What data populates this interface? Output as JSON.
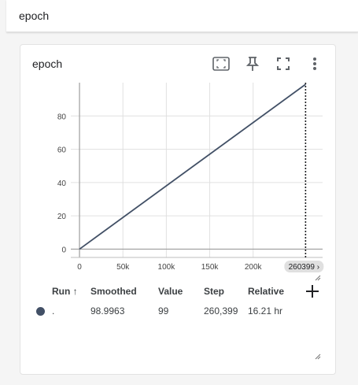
{
  "group": {
    "title": "epoch"
  },
  "card": {
    "title": "epoch",
    "toolbar": [
      "fit-domain-icon",
      "pin-icon",
      "fullscreen-icon",
      "more-vert-icon"
    ]
  },
  "chart_data": {
    "type": "line",
    "x_ticks": [
      "0",
      "50k",
      "100k",
      "150k",
      "200k"
    ],
    "y_ticks": [
      "0",
      "20",
      "40",
      "60",
      "80"
    ],
    "xlim": [
      -10000,
      280000
    ],
    "ylim": [
      -5,
      100
    ],
    "series": [
      {
        "name": ".",
        "color": "#425066",
        "x": [
          0,
          260399
        ],
        "y": [
          0,
          99
        ]
      }
    ],
    "cursor_step": 260399,
    "cursor_label": "260399 ›",
    "grid": true
  },
  "legend": {
    "headers": {
      "run": "Run ↑",
      "smoothed": "Smoothed",
      "value": "Value",
      "step": "Step",
      "relative": "Relative"
    },
    "rows": [
      {
        "run": ".",
        "smoothed": "98.9963",
        "value": "99",
        "step": "260,399",
        "relative": "16.21 hr",
        "color": "#425066"
      }
    ]
  }
}
